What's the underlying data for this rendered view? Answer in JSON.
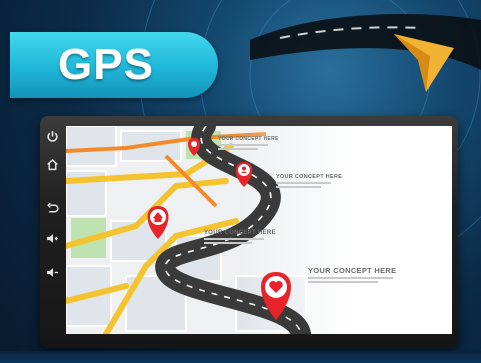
{
  "badge": {
    "title": "GPS"
  },
  "device": {
    "side_buttons": [
      {
        "icon": "power-icon"
      },
      {
        "icon": "home-icon"
      },
      {
        "icon": "back-icon"
      },
      {
        "icon": "volume-up-icon"
      },
      {
        "icon": "volume-down-icon"
      }
    ]
  },
  "screen": {
    "concepts": [
      {
        "text": "YOUR CONCEPT HERE"
      },
      {
        "text": "YOUR CONCEPT HERE"
      },
      {
        "text": "YOUR CONCEPT HERE"
      },
      {
        "text": "YOUR CONCEPT HERE"
      }
    ]
  },
  "colors": {
    "accent": "#1fb6d8",
    "pin": "#e8232a",
    "road": "#3a3a3a",
    "map_road": "#f4c430"
  }
}
